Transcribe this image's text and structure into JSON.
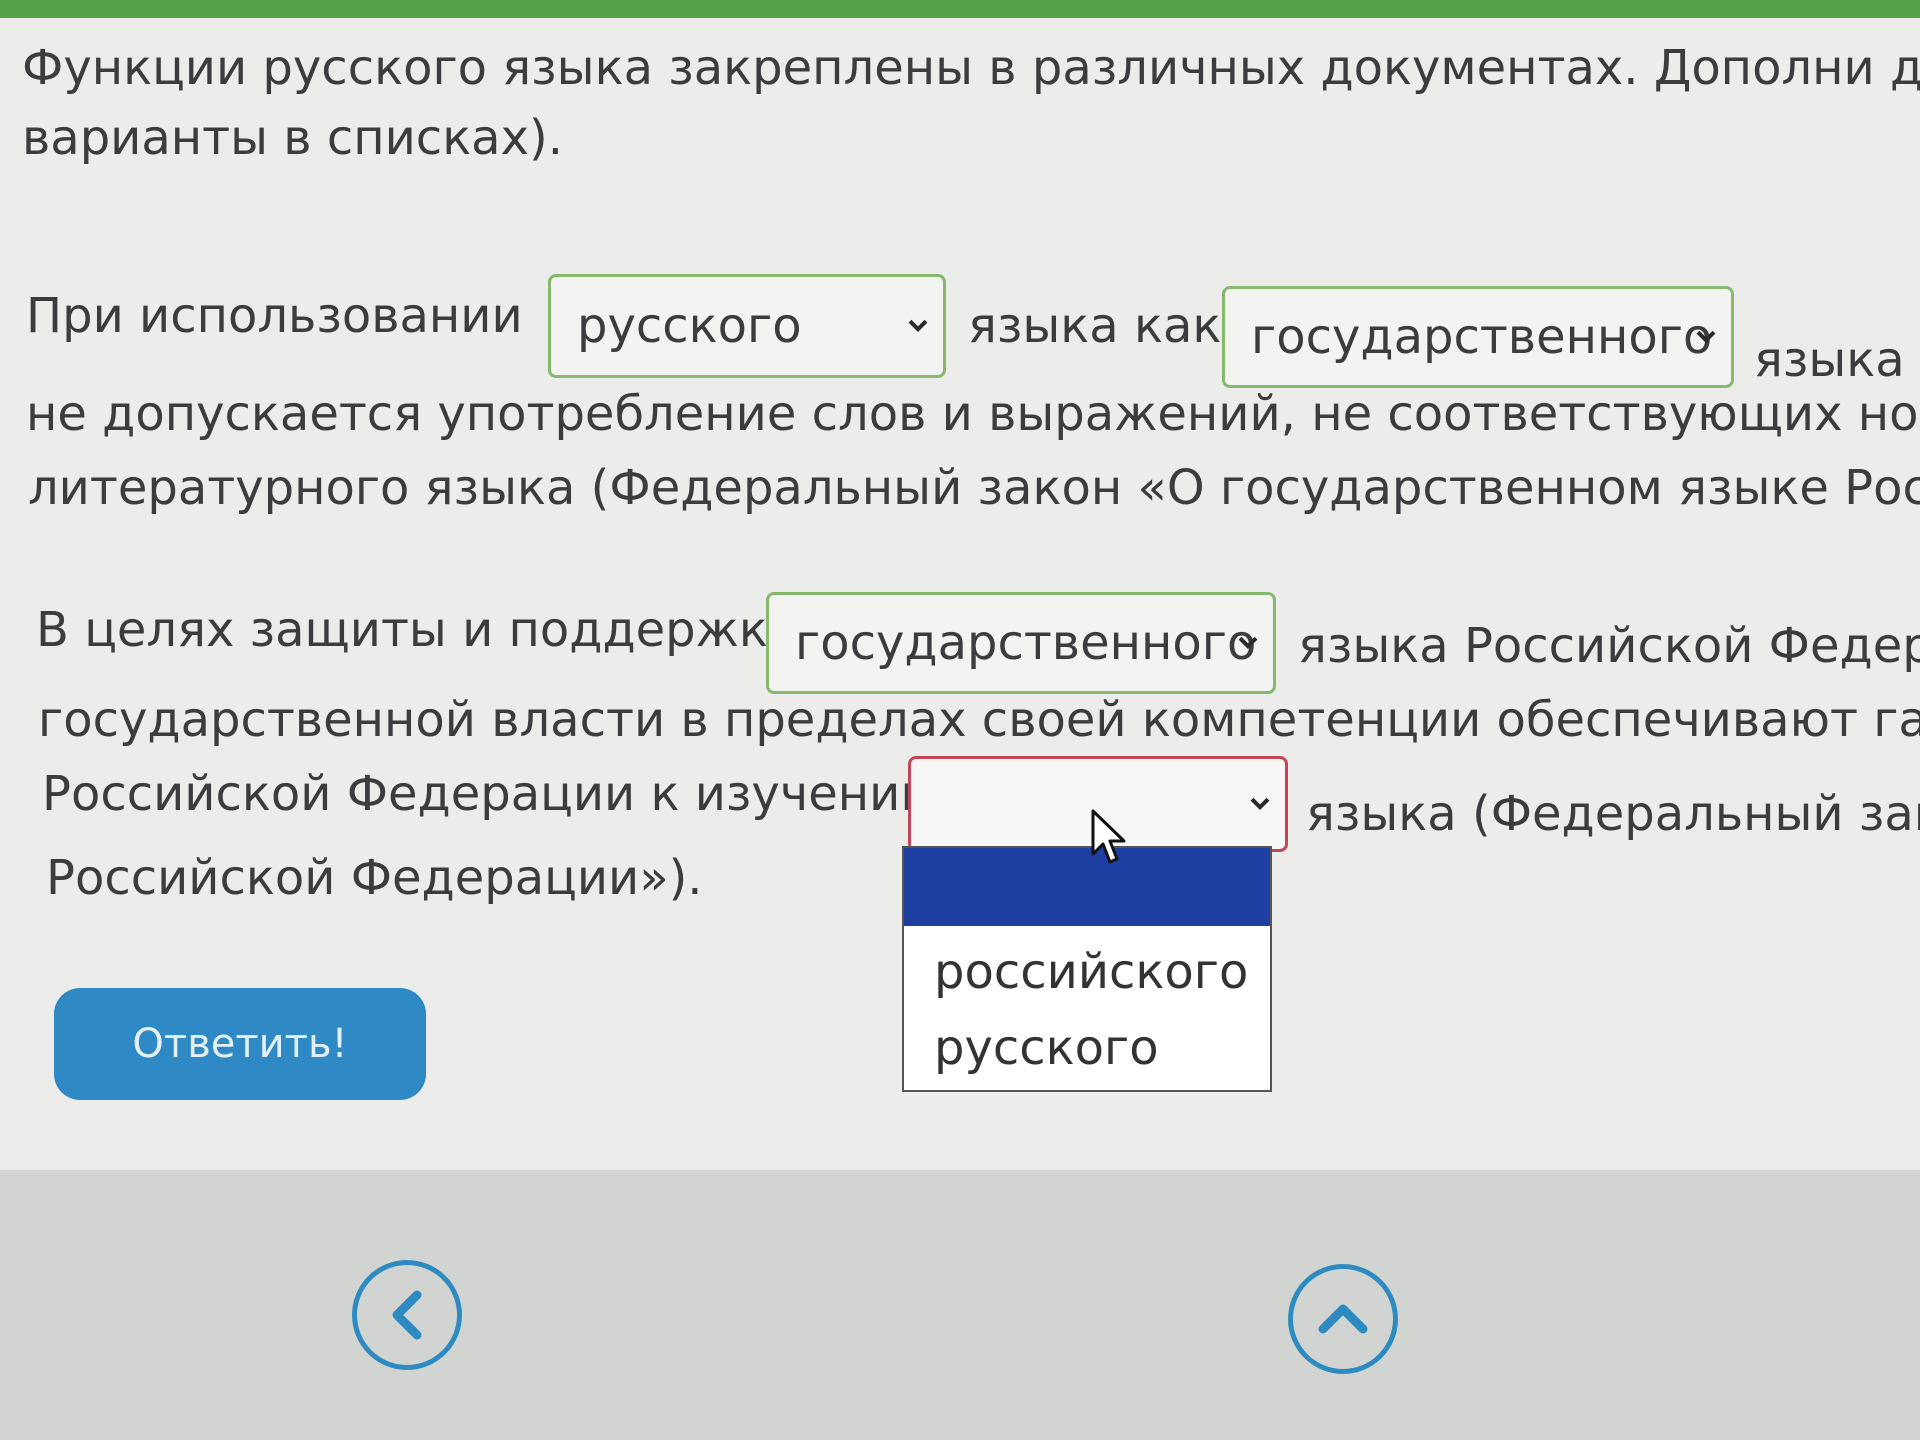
{
  "instructions": {
    "line1": "Функции русского языка закреплены в различных документах. Дополни данн",
    "line2": "варианты в списках)."
  },
  "sentence1": {
    "before_select1": "При использовании",
    "select1_value": "русского",
    "between": "языка как",
    "select2_value": "государственного",
    "after_select2": "языка Р",
    "line2": "не допускается употребление слов и выражений, не соответствующих нормам",
    "line3": "литературного языка (Федеральный закон «О государственном языке Российск"
  },
  "sentence2": {
    "before_select3": "В целях защиты и поддержки",
    "select3_value": "государственного",
    "after_select3": "языка Российской Федерац",
    "line2": "государственной власти в пределах своей компетенции обеспечивают гарантии",
    "before_select4": "Российской Федерации к изучению",
    "select4_value": "",
    "after_select4": "языка (Федеральный закон",
    "line4": "Российской Федерации»)."
  },
  "dropdown": {
    "options": [
      "",
      "российского",
      "русского"
    ],
    "highlight_color": "#1e3fa2"
  },
  "answer_button": {
    "label": "Ответить!",
    "color": "#2e89c5"
  },
  "navigation": {
    "back_icon": "chevron-left-icon",
    "up_icon": "chevron-up-icon"
  },
  "colors": {
    "accent_green": "#56a24a",
    "valid_border": "#86b96e",
    "invalid_border": "#c2455a"
  }
}
